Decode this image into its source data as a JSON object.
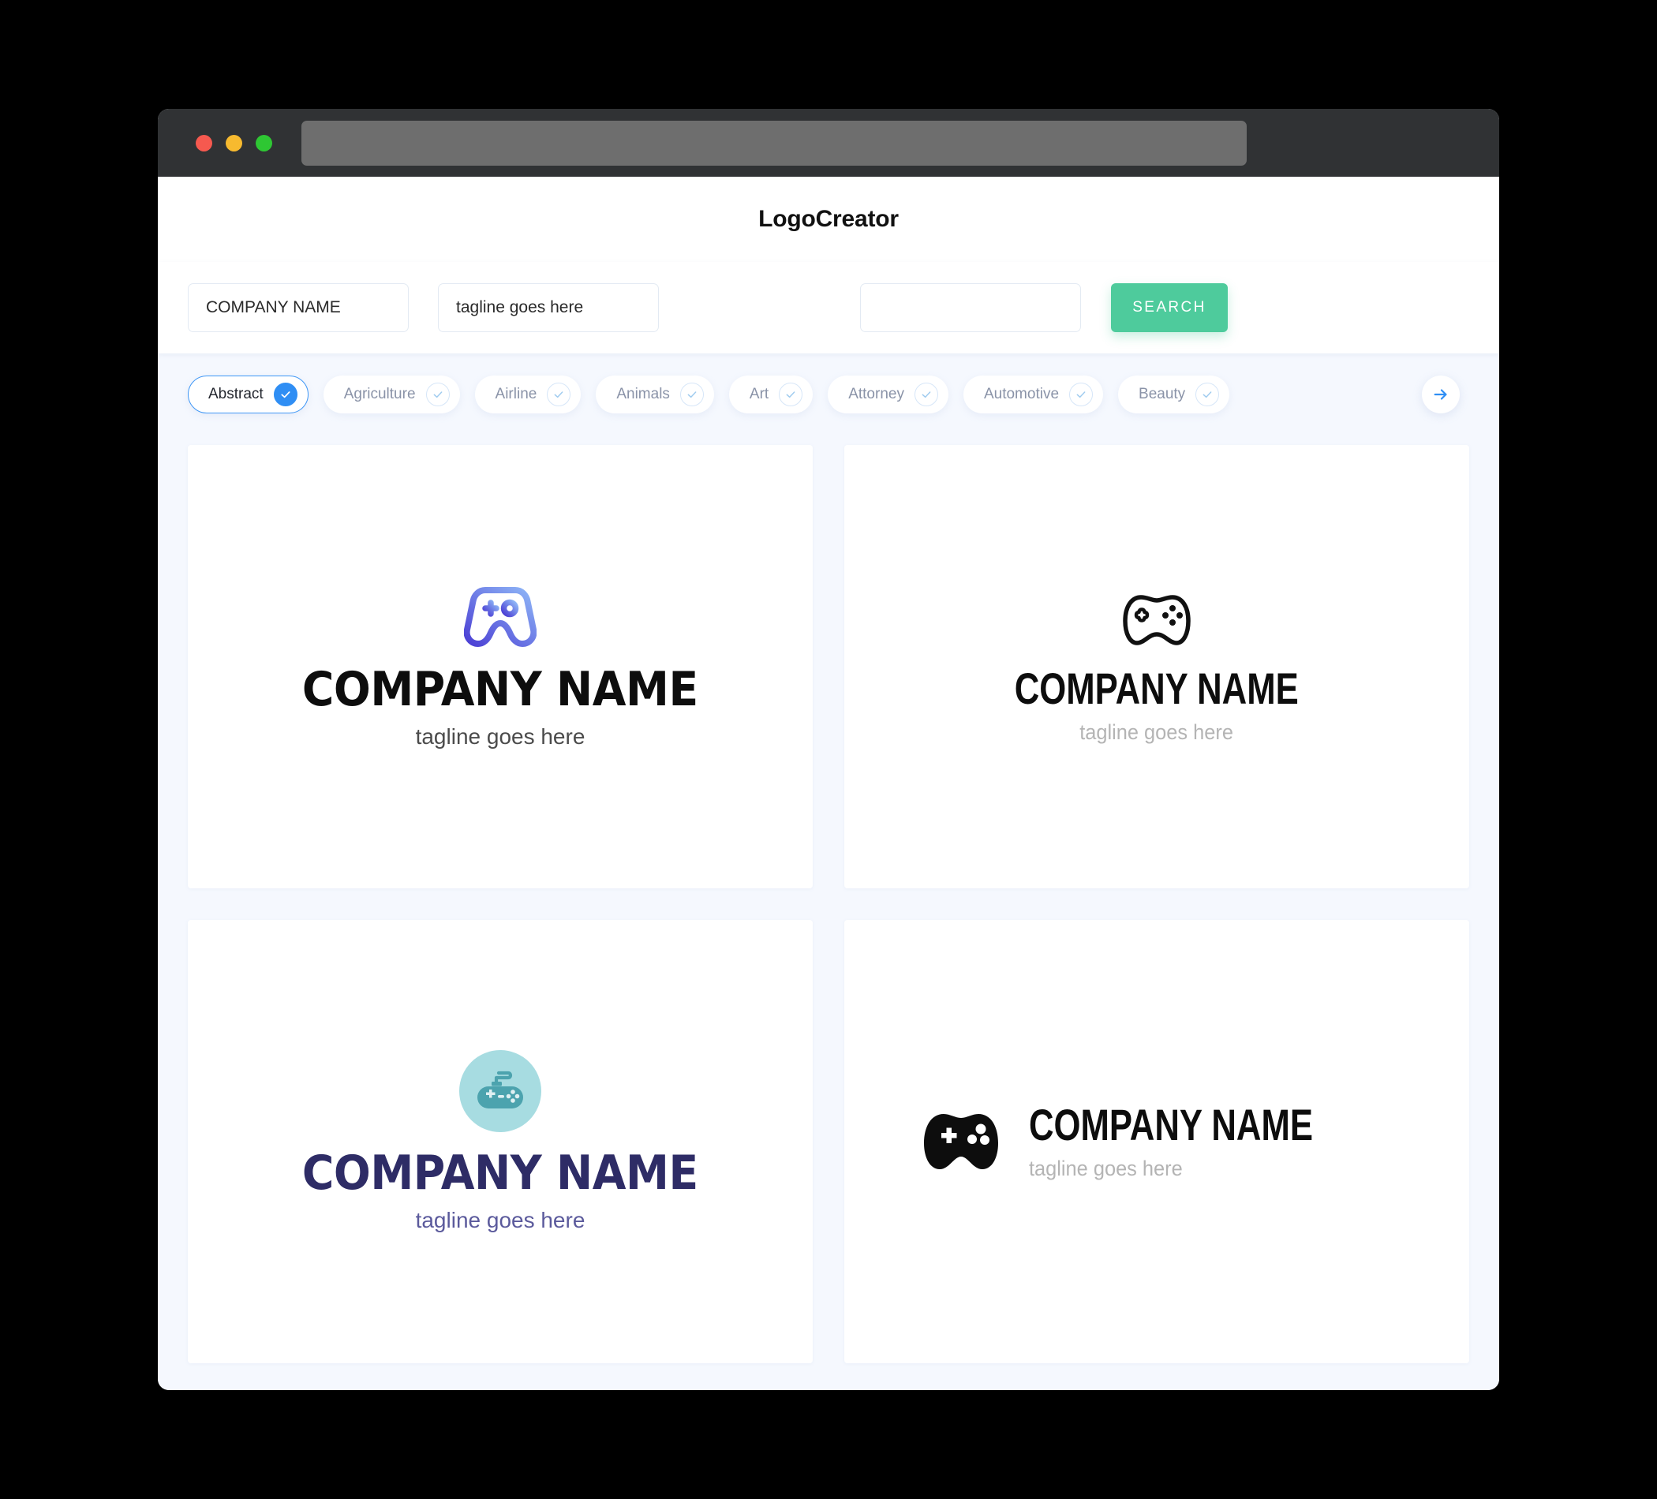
{
  "browser": {
    "traffic_lights": [
      "close",
      "minimize",
      "maximize"
    ],
    "url_value": ""
  },
  "header": {
    "title": "LogoCreator"
  },
  "search": {
    "company_value": "COMPANY NAME",
    "company_placeholder": "COMPANY NAME",
    "tagline_value": "tagline goes here",
    "tagline_placeholder": "tagline goes here",
    "extra_value": "",
    "extra_placeholder": "",
    "button_label": "SEARCH",
    "button_color": "#4ecb9c"
  },
  "categories": {
    "selected": "Abstract",
    "accent_color": "#2f8ef4",
    "next_label": "next",
    "items": [
      {
        "label": "Abstract",
        "selected": true
      },
      {
        "label": "Agriculture",
        "selected": false
      },
      {
        "label": "Airline",
        "selected": false
      },
      {
        "label": "Animals",
        "selected": false
      },
      {
        "label": "Art",
        "selected": false
      },
      {
        "label": "Attorney",
        "selected": false
      },
      {
        "label": "Automotive",
        "selected": false
      },
      {
        "label": "Beauty",
        "selected": false
      }
    ]
  },
  "results": {
    "cards": [
      {
        "icon": "gamepad-outline-gradient-icon",
        "name": "COMPANY NAME",
        "tagline": "tagline goes here",
        "name_color": "#0d0d0d",
        "tagline_color": "#4b4b4b",
        "icon_color_start": "#8fb7f7",
        "icon_color_end": "#4b3fd4",
        "layout": "stacked"
      },
      {
        "icon": "gamepad-outline-black-icon",
        "name": "COMPANY NAME",
        "tagline": "tagline goes here",
        "name_color": "#0d0d0d",
        "tagline_color": "#b4b4b4",
        "layout": "stacked"
      },
      {
        "icon": "gamepad-circle-teal-icon",
        "name": "COMPANY NAME",
        "tagline": "tagline goes here",
        "name_color": "#2e2c66",
        "tagline_color": "#5b5a9c",
        "icon_bg": "#a7dce1",
        "icon_fg": "#4ca3ae",
        "layout": "stacked"
      },
      {
        "icon": "gamepad-solid-black-icon",
        "name": "COMPANY NAME",
        "tagline": "tagline goes here",
        "name_color": "#0d0d0d",
        "tagline_color": "#b4b4b4",
        "layout": "horizontal"
      }
    ]
  }
}
